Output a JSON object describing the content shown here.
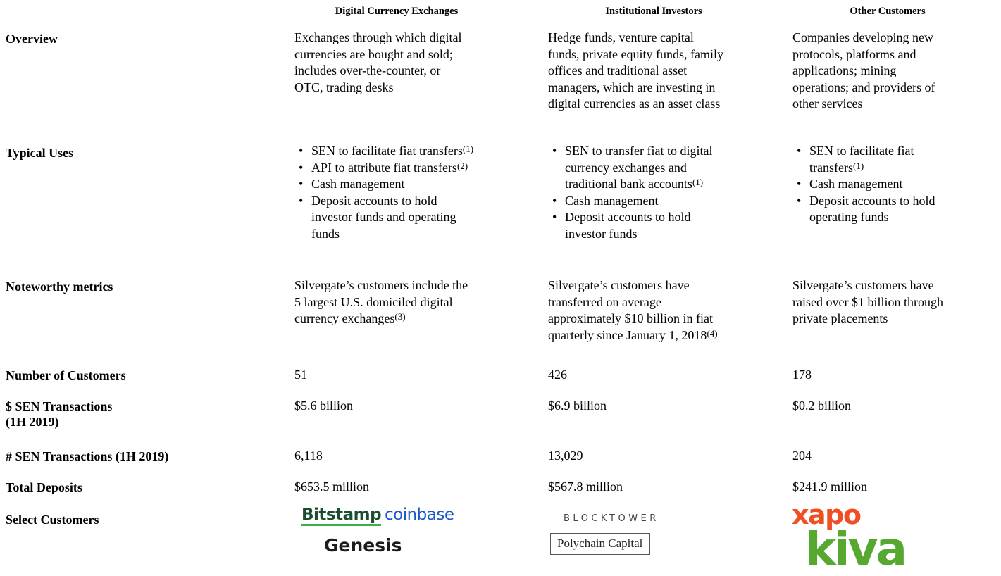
{
  "headers": {
    "col1": "Digital Currency Exchanges",
    "col2": "Institutional Investors",
    "col3": "Other Customers"
  },
  "rows": {
    "overview": {
      "label": "Overview",
      "col1": [
        "Exchanges through which digital",
        "currencies are bought and sold;",
        "includes over-the-counter, or",
        "OTC, trading desks"
      ],
      "col2": [
        "Hedge funds, venture capital",
        "funds, private equity funds, family",
        "offices and traditional asset",
        "managers, which are investing in",
        "digital currencies as an asset class"
      ],
      "col3": [
        "Companies developing new",
        "protocols, platforms and",
        "applications; mining",
        "operations; and providers of",
        "other services"
      ]
    },
    "typical_uses": {
      "label": "Typical Uses",
      "col1": [
        {
          "lines": [
            "SEN to facilitate fiat transfers"
          ],
          "fn": "(1)"
        },
        {
          "lines": [
            "API to attribute fiat transfers"
          ],
          "fn": "(2)"
        },
        {
          "lines": [
            "Cash management"
          ],
          "fn": ""
        },
        {
          "lines": [
            "Deposit accounts to hold",
            "investor funds and operating",
            "funds"
          ],
          "fn": ""
        }
      ],
      "col2": [
        {
          "lines": [
            "SEN to transfer fiat to digital",
            "currency exchanges and",
            "traditional bank accounts"
          ],
          "fn": "(1)"
        },
        {
          "lines": [
            "Cash management"
          ],
          "fn": ""
        },
        {
          "lines": [
            "Deposit accounts to hold",
            "investor funds"
          ],
          "fn": ""
        }
      ],
      "col3": [
        {
          "lines": [
            "SEN to facilitate fiat",
            "transfers"
          ],
          "fn": "(1)"
        },
        {
          "lines": [
            "Cash management"
          ],
          "fn": ""
        },
        {
          "lines": [
            "Deposit accounts to hold",
            "operating funds"
          ],
          "fn": ""
        }
      ]
    },
    "noteworthy": {
      "label": "Noteworthy metrics",
      "col1": {
        "lines": [
          "Silvergate’s customers include the",
          "5 largest U.S. domiciled digital",
          "currency exchanges"
        ],
        "fn": "(3)"
      },
      "col2": {
        "lines": [
          "Silvergate’s customers have",
          "transferred on average",
          "approximately $10 billion in fiat",
          "quarterly since January 1, 2018"
        ],
        "fn": "(4)"
      },
      "col3": {
        "lines": [
          "Silvergate’s customers have",
          "raised over $1 billion through",
          "private placements"
        ],
        "fn": ""
      }
    },
    "num_customers": {
      "label": "Number of Customers",
      "col1": "51",
      "col2": "426",
      "col3": "178"
    },
    "sen_dollars": {
      "label_lines": [
        "$ SEN Transactions",
        "(1H 2019)"
      ],
      "col1": "$5.6 billion",
      "col2": "$6.9 billion",
      "col3": "$0.2 billion"
    },
    "sen_count": {
      "label": "# SEN Transactions (1H 2019)",
      "col1": "6,118",
      "col2": "13,029",
      "col3": "204"
    },
    "total_deposits": {
      "label": "Total Deposits",
      "col1": "$653.5 million",
      "col2": "$567.8 million",
      "col3": "$241.9 million"
    },
    "select_customers": {
      "label": "Select Customers",
      "logos": {
        "bitstamp": "Bitstamp",
        "coinbase": "coinbase",
        "genesis": "Genesis",
        "blocktower": "BLOCKTOWER",
        "polychain": "Polychain Capital",
        "xapo": "xapo",
        "kiva": "kiva"
      }
    }
  },
  "colors": {
    "bitstamp": "#1b4d2f",
    "bitstamp_underline": "#3bb04a",
    "coinbase": "#1a5ac8",
    "xapo": "#f04e23",
    "kiva": "#56a830"
  }
}
